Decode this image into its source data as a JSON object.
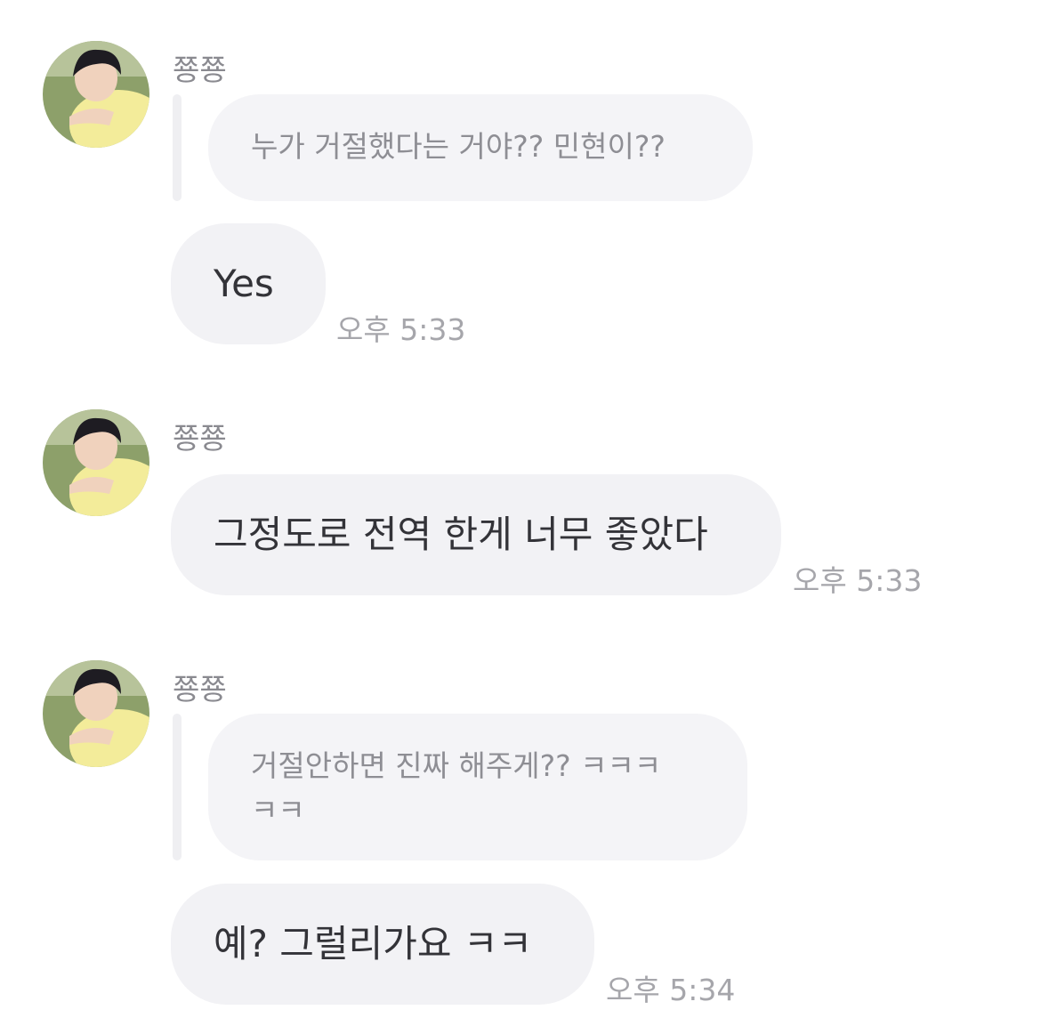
{
  "messages": [
    {
      "sender": "쭁쭁",
      "avatar_icon": "profile-photo-icon",
      "quote": "누가 거절했다는 거야?? 민현이??",
      "text": "Yes",
      "time": "오후 5:33"
    },
    {
      "sender": "쭁쭁",
      "avatar_icon": "profile-photo-icon",
      "text": "그정도로 전역 한게 너무 좋았다",
      "time": "오후 5:33"
    },
    {
      "sender": "쭁쭁",
      "avatar_icon": "profile-photo-icon",
      "quote_line1": "거절안하면 진짜 해주게?? ㅋㅋㅋ",
      "quote_line2": "ㅋㅋ",
      "text": "예? 그럴리가요 ㅋㅋ",
      "time": "오후 5:34"
    }
  ],
  "colors": {
    "bubble_bg": "#f2f2f5",
    "quote_bg": "#f4f4f7",
    "text": "#333338",
    "meta": "#a6a6ab"
  }
}
